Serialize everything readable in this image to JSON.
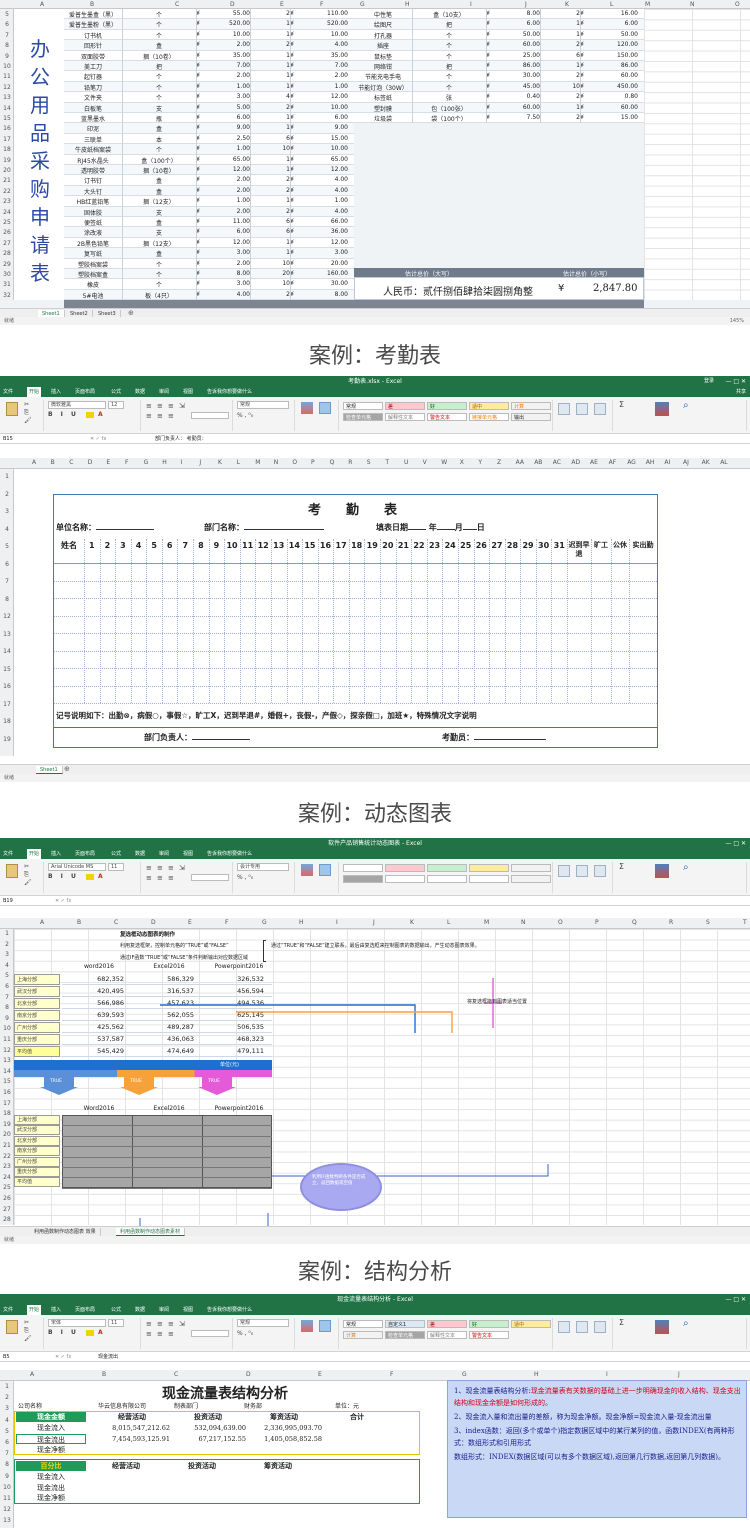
{
  "sheet1": {
    "vertical_title": "办公用品采购申请表",
    "rows_left": [
      {
        "r": "5",
        "name": "爱普生墨盒（黑）",
        "unit": "个",
        "price": "55.00",
        "qty": "2",
        "total": "110.00"
      },
      {
        "r": "6",
        "name": "爱普生墨粉（黑）",
        "unit": "个",
        "price": "520.00",
        "qty": "1",
        "total": "520.00"
      },
      {
        "r": "7",
        "name": "订书机",
        "unit": "个",
        "price": "10.00",
        "qty": "1",
        "total": "10.00"
      },
      {
        "r": "8",
        "name": "回形针",
        "unit": "盒",
        "price": "2.00",
        "qty": "2",
        "total": "4.00"
      },
      {
        "r": "9",
        "name": "双面胶带",
        "unit": "捆（10卷）",
        "price": "35.00",
        "qty": "1",
        "total": "35.00"
      },
      {
        "r": "10",
        "name": "美工刀",
        "unit": "把",
        "price": "7.00",
        "qty": "1",
        "total": "7.00"
      },
      {
        "r": "11",
        "name": "起钉器",
        "unit": "个",
        "price": "2.00",
        "qty": "1",
        "total": "2.00"
      },
      {
        "r": "12",
        "name": "铅笔刀",
        "unit": "个",
        "price": "1.00",
        "qty": "1",
        "total": "1.00"
      },
      {
        "r": "13",
        "name": "文件夹",
        "unit": "个",
        "price": "3.00",
        "qty": "4",
        "total": "12.00"
      },
      {
        "r": "14",
        "name": "白板笔",
        "unit": "支",
        "price": "5.00",
        "qty": "2",
        "total": "10.00"
      },
      {
        "r": "15",
        "name": "蓝黑墨水",
        "unit": "瓶",
        "price": "6.00",
        "qty": "1",
        "total": "6.00"
      },
      {
        "r": "16",
        "name": "印泥",
        "unit": "盒",
        "price": "9.00",
        "qty": "1",
        "total": "9.00"
      },
      {
        "r": "17",
        "name": "三联单",
        "unit": "本",
        "price": "2.50",
        "qty": "6",
        "total": "15.00"
      },
      {
        "r": "18",
        "name": "牛皮纸档案袋",
        "unit": "个",
        "price": "1.00",
        "qty": "10",
        "total": "10.00"
      },
      {
        "r": "19",
        "name": "RJ45水晶头",
        "unit": "盒（100个）",
        "price": "65.00",
        "qty": "1",
        "total": "65.00"
      },
      {
        "r": "20",
        "name": "透明胶带",
        "unit": "捆（10卷）",
        "price": "12.00",
        "qty": "1",
        "total": "12.00"
      },
      {
        "r": "21",
        "name": "订书钉",
        "unit": "盒",
        "price": "2.00",
        "qty": "2",
        "total": "4.00"
      },
      {
        "r": "22",
        "name": "大头钉",
        "unit": "盒",
        "price": "2.00",
        "qty": "2",
        "total": "4.00"
      },
      {
        "r": "23",
        "name": "HB红蓝铅笔",
        "unit": "捆（12支）",
        "price": "1.00",
        "qty": "1",
        "total": "1.00"
      },
      {
        "r": "24",
        "name": "固体胶",
        "unit": "支",
        "price": "2.00",
        "qty": "2",
        "total": "4.00"
      },
      {
        "r": "25",
        "name": "便签纸",
        "unit": "盒",
        "price": "11.00",
        "qty": "6",
        "total": "66.00"
      },
      {
        "r": "26",
        "name": "涂改液",
        "unit": "支",
        "price": "6.00",
        "qty": "6",
        "total": "36.00"
      },
      {
        "r": "27",
        "name": "2B黑色铅笔",
        "unit": "捆（12支）",
        "price": "12.00",
        "qty": "1",
        "total": "12.00"
      },
      {
        "r": "28",
        "name": "复写纸",
        "unit": "盒",
        "price": "3.00",
        "qty": "1",
        "total": "3.00"
      },
      {
        "r": "29",
        "name": "塑胶档案袋",
        "unit": "个",
        "price": "2.00",
        "qty": "10",
        "total": "20.00"
      },
      {
        "r": "30",
        "name": "塑胶档案盒",
        "unit": "个",
        "price": "8.00",
        "qty": "20",
        "total": "160.00"
      },
      {
        "r": "31",
        "name": "橡皮",
        "unit": "个",
        "price": "3.00",
        "qty": "10",
        "total": "30.00"
      },
      {
        "r": "32",
        "name": "5#电池",
        "unit": "板（4只）",
        "price": "4.00",
        "qty": "2",
        "total": "8.00"
      }
    ],
    "rows_right": [
      {
        "name": "中性笔",
        "unit": "盒（10支）",
        "price": "8.00",
        "qty": "2",
        "total": "16.00"
      },
      {
        "name": "绘图尺",
        "unit": "把",
        "price": "6.00",
        "qty": "1",
        "total": "6.00"
      },
      {
        "name": "打孔器",
        "unit": "个",
        "price": "50.00",
        "qty": "1",
        "total": "50.00"
      },
      {
        "name": "插座",
        "unit": "个",
        "price": "60.00",
        "qty": "2",
        "total": "120.00"
      },
      {
        "name": "鼠标垫",
        "unit": "个",
        "price": "25.00",
        "qty": "6",
        "total": "150.00"
      },
      {
        "name": "网络钳",
        "unit": "把",
        "price": "86.00",
        "qty": "1",
        "total": "86.00"
      },
      {
        "name": "节能充电手电",
        "unit": "个",
        "price": "30.00",
        "qty": "2",
        "total": "60.00"
      },
      {
        "name": "节能灯泡（30W）",
        "unit": "个",
        "price": "45.00",
        "qty": "10",
        "total": "450.00"
      },
      {
        "name": "标签纸",
        "unit": "张",
        "price": "0.40",
        "qty": "2",
        "total": "0.80"
      },
      {
        "name": "塑封膜",
        "unit": "包（100张）",
        "price": "60.00",
        "qty": "1",
        "total": "60.00"
      },
      {
        "name": "垃圾袋",
        "unit": "袋（100个）",
        "price": "7.50",
        "qty": "2",
        "total": "15.00"
      }
    ],
    "yen": "¥",
    "col_letters": [
      "A",
      "B",
      "C",
      "D",
      "E",
      "F",
      "G",
      "H",
      "I",
      "J",
      "K",
      "L",
      "M",
      "N",
      "O"
    ],
    "est_upper_label": "估计总价（大写）",
    "est_lower_label": "估计总价（小写）",
    "rmb_text": "人民币：贰仟捌佰肆拾柒圆捌角整",
    "total_value": "2,847.80",
    "tabs": [
      "Sheet1",
      "Sheet2",
      "Sheet3"
    ],
    "status": "就绪",
    "zoom": "145%"
  },
  "captions": [
    "案例：考勤表",
    "案例：动态图表",
    "案例：结构分析"
  ],
  "attendance": {
    "window_title": "考勤表.xlsx - Excel",
    "ribbon_tabs": [
      "文件",
      "开始",
      "插入",
      "页面布局",
      "公式",
      "数据",
      "审阅",
      "视图",
      "告诉我你想要做什么"
    ],
    "user": "登录",
    "share": "共享",
    "font": "微软雅黑",
    "font_size": "12",
    "number_format": "常规",
    "cell_ref": "B15",
    "formula": "部门负责人：                                             考勤员：",
    "styles": [
      "常规",
      "差",
      "好",
      "适中",
      "计算",
      "检查单元格",
      "解释性文本",
      "警告文本",
      "链接单元格",
      "输出"
    ],
    "title": "考　勤　表",
    "unit_label": "单位名称：",
    "dept_label": "部门名称：",
    "date_label": "填表日期",
    "year": "年",
    "month": "月",
    "day": "日",
    "headers": [
      "姓名",
      "1",
      "2",
      "3",
      "4",
      "5",
      "6",
      "7",
      "8",
      "9",
      "10",
      "11",
      "12",
      "13",
      "14",
      "15",
      "16",
      "17",
      "18",
      "19",
      "20",
      "21",
      "22",
      "23",
      "24",
      "25",
      "26",
      "27",
      "28",
      "29",
      "30",
      "31",
      "迟到早退",
      "旷工",
      "公休",
      "实出勤"
    ],
    "note": "记号说明如下：出勤⊗，病假○，事假☆，旷工X，迟到早退#，婚假+，丧假-，产假◇，探亲假□，加班★，特殊情况文字说明",
    "dept_head": "部门负责人：",
    "clerk": "考勤员：",
    "tabs": [
      "Sheet1"
    ],
    "status": "就绪"
  },
  "dynamic": {
    "window_title": "软件产品销售统计动态图表 - Excel",
    "ribbon_tabs": [
      "文件",
      "开始",
      "插入",
      "页面布局",
      "公式",
      "数据",
      "审阅",
      "视图",
      "告诉我你想要做什么"
    ],
    "font": "Arial Unicode MS",
    "font_size": "11",
    "number_format": "会计专用",
    "cell_ref": "B19",
    "note_title": "复选框动态图表的制作",
    "note1": "利用复选框架，控制单元格的“TRUE”或“FALSE”",
    "note2": "通过IF函数“TRUE”或“FALSE”条件判断输出对应数据区域",
    "note3": "通过“TRUE”和“FALSE”建立联系，最后由复选框来控制图表的数据输出，产生动态图表效果。",
    "side_note": "将复选框拖到图表适当位置",
    "cols": [
      "word2016",
      "Excel2016",
      "Powerpoint2016"
    ],
    "rows": [
      {
        "name": "上海分部",
        "v": [
          "682,352",
          "586,329",
          "326,532"
        ]
      },
      {
        "name": "武汉分部",
        "v": [
          "420,495",
          "316,537",
          "456,594"
        ]
      },
      {
        "name": "北京分部",
        "v": [
          "566,986",
          "457,623",
          "494,536"
        ]
      },
      {
        "name": "南京分部",
        "v": [
          "639,593",
          "562,055",
          "625,145"
        ]
      },
      {
        "name": "广州分部",
        "v": [
          "425,562",
          "489,287",
          "506,535"
        ]
      },
      {
        "name": "重庆分部",
        "v": [
          "537,587",
          "436,063",
          "468,323"
        ]
      },
      {
        "name": "平均值",
        "v": [
          "545,429",
          "474,649",
          "479,111"
        ]
      }
    ],
    "unit_bar": "单位(元)",
    "true_labels": [
      "TRUE",
      "TRUE",
      "TRUE"
    ],
    "cols2": [
      "Word2016",
      "Excel2016",
      "Powerpoint2016"
    ],
    "rows2": [
      "上海分部",
      "武汉分部",
      "北京分部",
      "南京分部",
      "广州分部",
      "重庆分部",
      "平均值"
    ],
    "cloud": "利用IF函数判断条件是否成立，返回数据或空值",
    "tabs": [
      "利用函数制作动态图表 效果",
      "利用函数制作动态图表素材"
    ],
    "status": "就绪"
  },
  "cashflow": {
    "window_title": "现金流量表结构分析 - Excel",
    "ribbon_tabs": [
      "文件",
      "开始",
      "插入",
      "页面布局",
      "公式",
      "数据",
      "审阅",
      "视图",
      "告诉我你想要做什么"
    ],
    "font": "宋体",
    "font_size": "11",
    "number_format": "常规",
    "cell_ref": "B5",
    "formula": "现金流出",
    "title": "现金流量表结构分析",
    "company_label": "公司名称",
    "company": "华云信息有限公司",
    "dept_label": "制表部门",
    "dept": "财务部",
    "unit": "单位：元",
    "head": [
      "现金金额",
      "经营活动",
      "投资活动",
      "筹资活动",
      "合计"
    ],
    "rows": [
      {
        "name": "现金流入",
        "v": [
          "8,015,547,212.62",
          "532,094,639.00",
          "2,336,995,093.70",
          ""
        ]
      },
      {
        "name": "现金流出",
        "v": [
          "7,454,593,125.91",
          "67,217,152.55",
          "1,405,058,852.58",
          ""
        ]
      },
      {
        "name": "现金净额",
        "v": [
          "",
          "",
          "",
          ""
        ]
      }
    ],
    "head2": [
      "百分比",
      "经营活动",
      "投资活动",
      "筹资活动"
    ],
    "rows2": [
      "现金流入",
      "现金流出",
      "现金净额"
    ],
    "notes": [
      {
        "n": "1、现金流量表结构分析:",
        "red": "现金流量表有关数据的基础上进一步明确现金的收入结构、现金支出结构和现金余额是如何形成的。",
        "black": ""
      },
      {
        "n": "2、现金流入量和流出量的差额，称为现金净额。",
        "red": "",
        "black": "现金净额=现金流入量-现金流出量"
      },
      {
        "n": "3、index函数：",
        "red": "",
        "black": "返回(多个或单个)指定数据区域中的某行某列的值，函数INDEX(有两种形式：数组形式和引用形式"
      },
      {
        "n": "数组形式：",
        "red": "",
        "black": "INDEX(数据区域(可以有多个数据区域),返回第几行数据,返回第几列数据)。"
      }
    ],
    "ribbon_styles": [
      "常规",
      "自定义1",
      "差",
      "好",
      "适中",
      "计算",
      "检查单元格",
      "解释性文本",
      "警告文本"
    ]
  }
}
